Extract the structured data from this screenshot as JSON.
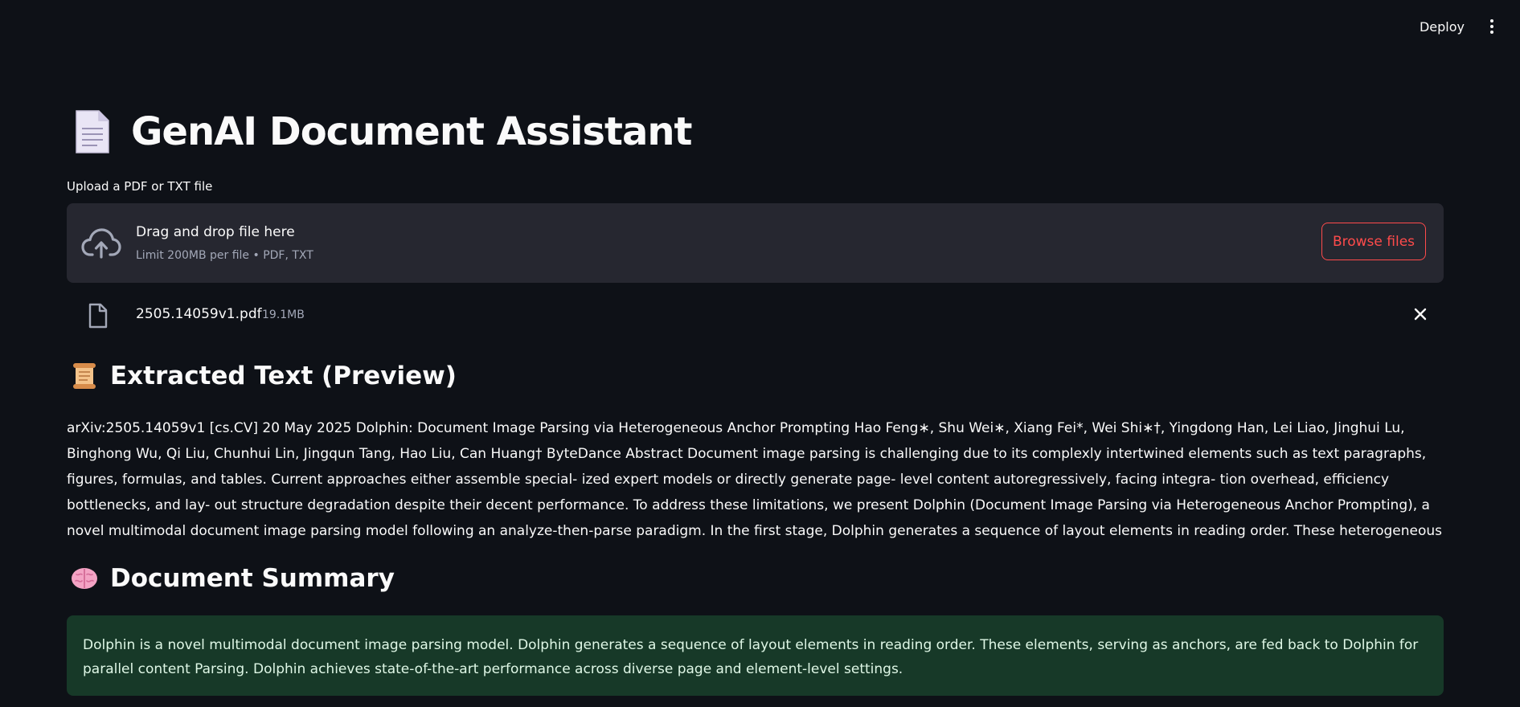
{
  "header": {
    "deploy_label": "Deploy",
    "menu_icon": "kebab-menu-icon"
  },
  "page": {
    "title": "GenAI Document Assistant",
    "title_icon": "document-emoji-icon"
  },
  "uploader": {
    "label": "Upload a PDF or TXT file",
    "drop_text": "Drag and drop file here",
    "limit_text": "Limit 200MB per file • PDF, TXT",
    "browse_label": "Browse files",
    "accent_color": "#ff4b4b"
  },
  "uploaded_file": {
    "name": "2505.14059v1.pdf",
    "size": "19.1MB"
  },
  "extracted": {
    "heading": "Extracted Text (Preview)",
    "heading_icon": "scroll-emoji-icon",
    "text": "arXiv:2505.14059v1 [cs.CV] 20 May 2025 Dolphin: Document Image Parsing via Heterogeneous Anchor Prompting Hao Feng∗, Shu Wei∗, Xiang Fei*, Wei Shi∗†, Yingdong Han, Lei Liao, Jinghui Lu, Binghong Wu, Qi Liu, Chunhui Lin, Jingqun Tang, Hao Liu, Can Huang† ByteDance Abstract Document image parsing is challenging due to its complexly intertwined elements such as text paragraphs, figures, formulas, and tables. Current approaches either assemble special- ized expert models or directly generate page- level content autoregressively, facing integra- tion overhead, efficiency bottlenecks, and lay- out structure degradation despite their decent performance. To address these limitations, we present Dolphin (Document Image Parsing via Heterogeneous Anchor Prompting), a novel multimodal document image parsing model following an analyze-then-parse paradigm. In the first stage, Dolphin generates a sequence of layout elements in reading order. These heterogeneous elements, serving as anchors and coup..."
  },
  "summary": {
    "heading": "Document Summary",
    "heading_icon": "brain-emoji-icon",
    "text": "Dolphin is a novel multimodal document image parsing model. Dolphin generates a sequence of layout elements in reading order. These elements, serving as anchors, are fed back to Dolphin for parallel content Parsing. Dolphin achieves state-of-the-art performance across diverse page and element-level settings.",
    "background_color": "#173928"
  }
}
